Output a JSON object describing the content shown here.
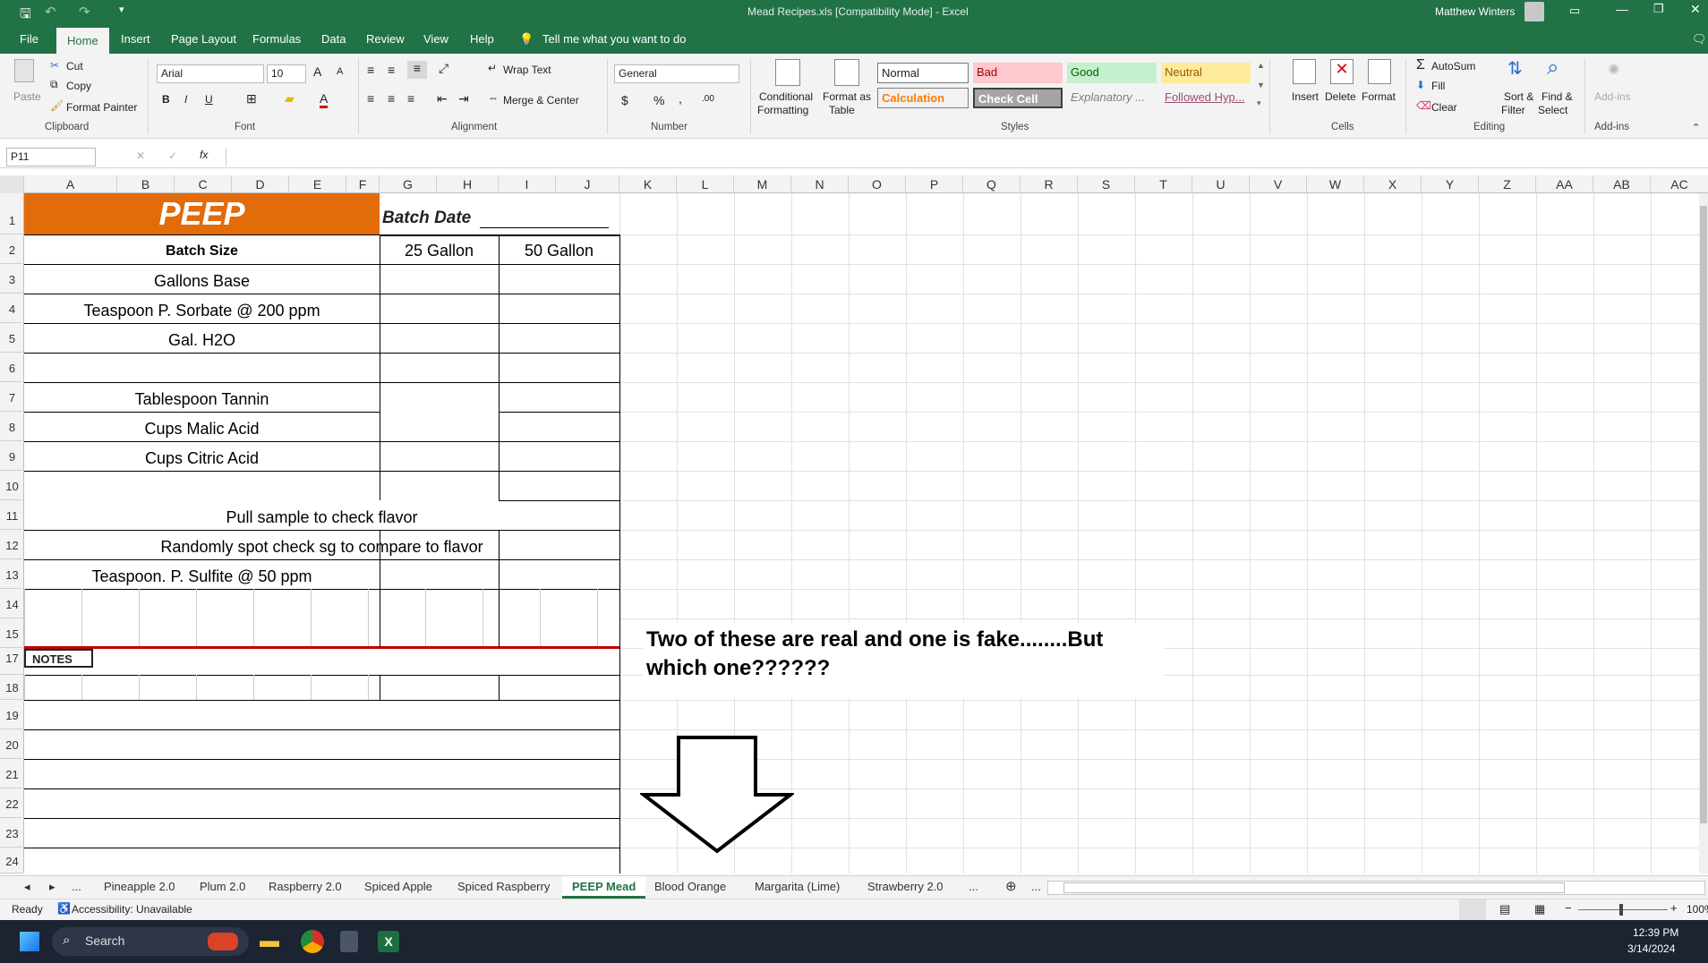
{
  "app": {
    "title": "Mead Recipes.xls  [Compatibility Mode]  -  Excel",
    "user": "Matthew Winters",
    "accent_color": "#217346"
  },
  "ribbon_tabs": [
    "File",
    "Home",
    "Insert",
    "Page Layout",
    "Formulas",
    "Data",
    "Review",
    "View",
    "Help"
  ],
  "tell_me": "Tell me what you want to do",
  "ribbon": {
    "clipboard": {
      "paste": "Paste",
      "cut": "Cut",
      "copy": "Copy",
      "format_painter": "Format Painter",
      "label": "Clipboard"
    },
    "font": {
      "name": "Arial",
      "size": "10",
      "bold": "B",
      "italic": "I",
      "underline": "U",
      "grow": "A",
      "shrink": "A",
      "font_color_glyph": "A",
      "label": "Font"
    },
    "alignment": {
      "wrap_text": "Wrap Text",
      "merge_center": "Merge & Center",
      "label": "Alignment"
    },
    "number": {
      "format": "General",
      "currency": "$",
      "percent": "%",
      "comma": ",",
      "inc_decimal": ".00",
      "label": "Number"
    },
    "styles": {
      "conditional_formatting": [
        "Conditional",
        "Formatting"
      ],
      "format_as_table": [
        "Format as",
        "Table"
      ],
      "normal": "Normal",
      "bad": "Bad",
      "good": "Good",
      "neutral": "Neutral",
      "calculation": "Calculation",
      "check_cell": "Check Cell",
      "explanatory": "Explanatory ...",
      "followed_hyp": "Followed Hyp...",
      "label": "Styles"
    },
    "cells": {
      "insert": "Insert",
      "delete": "Delete",
      "format": "Format",
      "label": "Cells"
    },
    "editing": {
      "autosum": "AutoSum",
      "fill": "Fill",
      "clear": "Clear",
      "sort_filter": [
        "Sort &",
        "Filter"
      ],
      "find_select": [
        "Find &",
        "Select"
      ],
      "label": "Editing"
    },
    "addins": {
      "addins": "Add-ins",
      "label": "Add-ins"
    }
  },
  "formula_bar": {
    "name_box": "P11",
    "cancel": "✕",
    "enter": "✓",
    "fx": "fx",
    "formula": ""
  },
  "columns": [
    "A",
    "B",
    "C",
    "D",
    "E",
    "F",
    "G",
    "H",
    "I",
    "J",
    "K",
    "L",
    "M",
    "N",
    "O",
    "P",
    "Q",
    "R",
    "S",
    "T",
    "U",
    "V",
    "W",
    "X",
    "Y",
    "Z",
    "AA",
    "AB",
    "AC"
  ],
  "rows": [
    "1",
    "2",
    "3",
    "4",
    "5",
    "6",
    "7",
    "8",
    "9",
    "10",
    "11",
    "12",
    "13",
    "14",
    "15",
    "17",
    "18",
    "19",
    "20",
    "21",
    "22",
    "23",
    "24"
  ],
  "sheet": {
    "title": "PEEP",
    "batch_date": "Batch Date",
    "batch_size": "Batch Size",
    "col_25": "25 Gallon",
    "col_50": "50 Gallon",
    "items": [
      "Gallons Base",
      "Teaspoon P. Sorbate @ 200 ppm",
      "Gal. H2O",
      "Tablespoon Tannin",
      "Cups Malic Acid",
      "Cups Citric Acid",
      "Pull sample to check flavor",
      "Randomly spot check sg to compare to flavor",
      "Teaspoon. P. Sulfite @ 50 ppm"
    ],
    "notes": "NOTES",
    "orange_color": "#e26b0a"
  },
  "overlay_text": "Two of these are real and one is fake........But which one??????",
  "sheet_tabs": [
    "...",
    "Pineapple 2.0",
    "Plum 2.0",
    "Raspberry 2.0",
    "Spiced Apple",
    "Spiced Raspberry",
    "PEEP Mead",
    "Blood Orange",
    "Margarita (Lime)",
    "Strawberry 2.0",
    "...",
    "..."
  ],
  "active_sheet": "PEEP Mead",
  "status": {
    "ready": "Ready",
    "accessibility": "Accessibility: Unavailable",
    "zoom": "100%"
  },
  "taskbar": {
    "search": "Search",
    "time": "12:39 PM",
    "date": "3/14/2024"
  }
}
